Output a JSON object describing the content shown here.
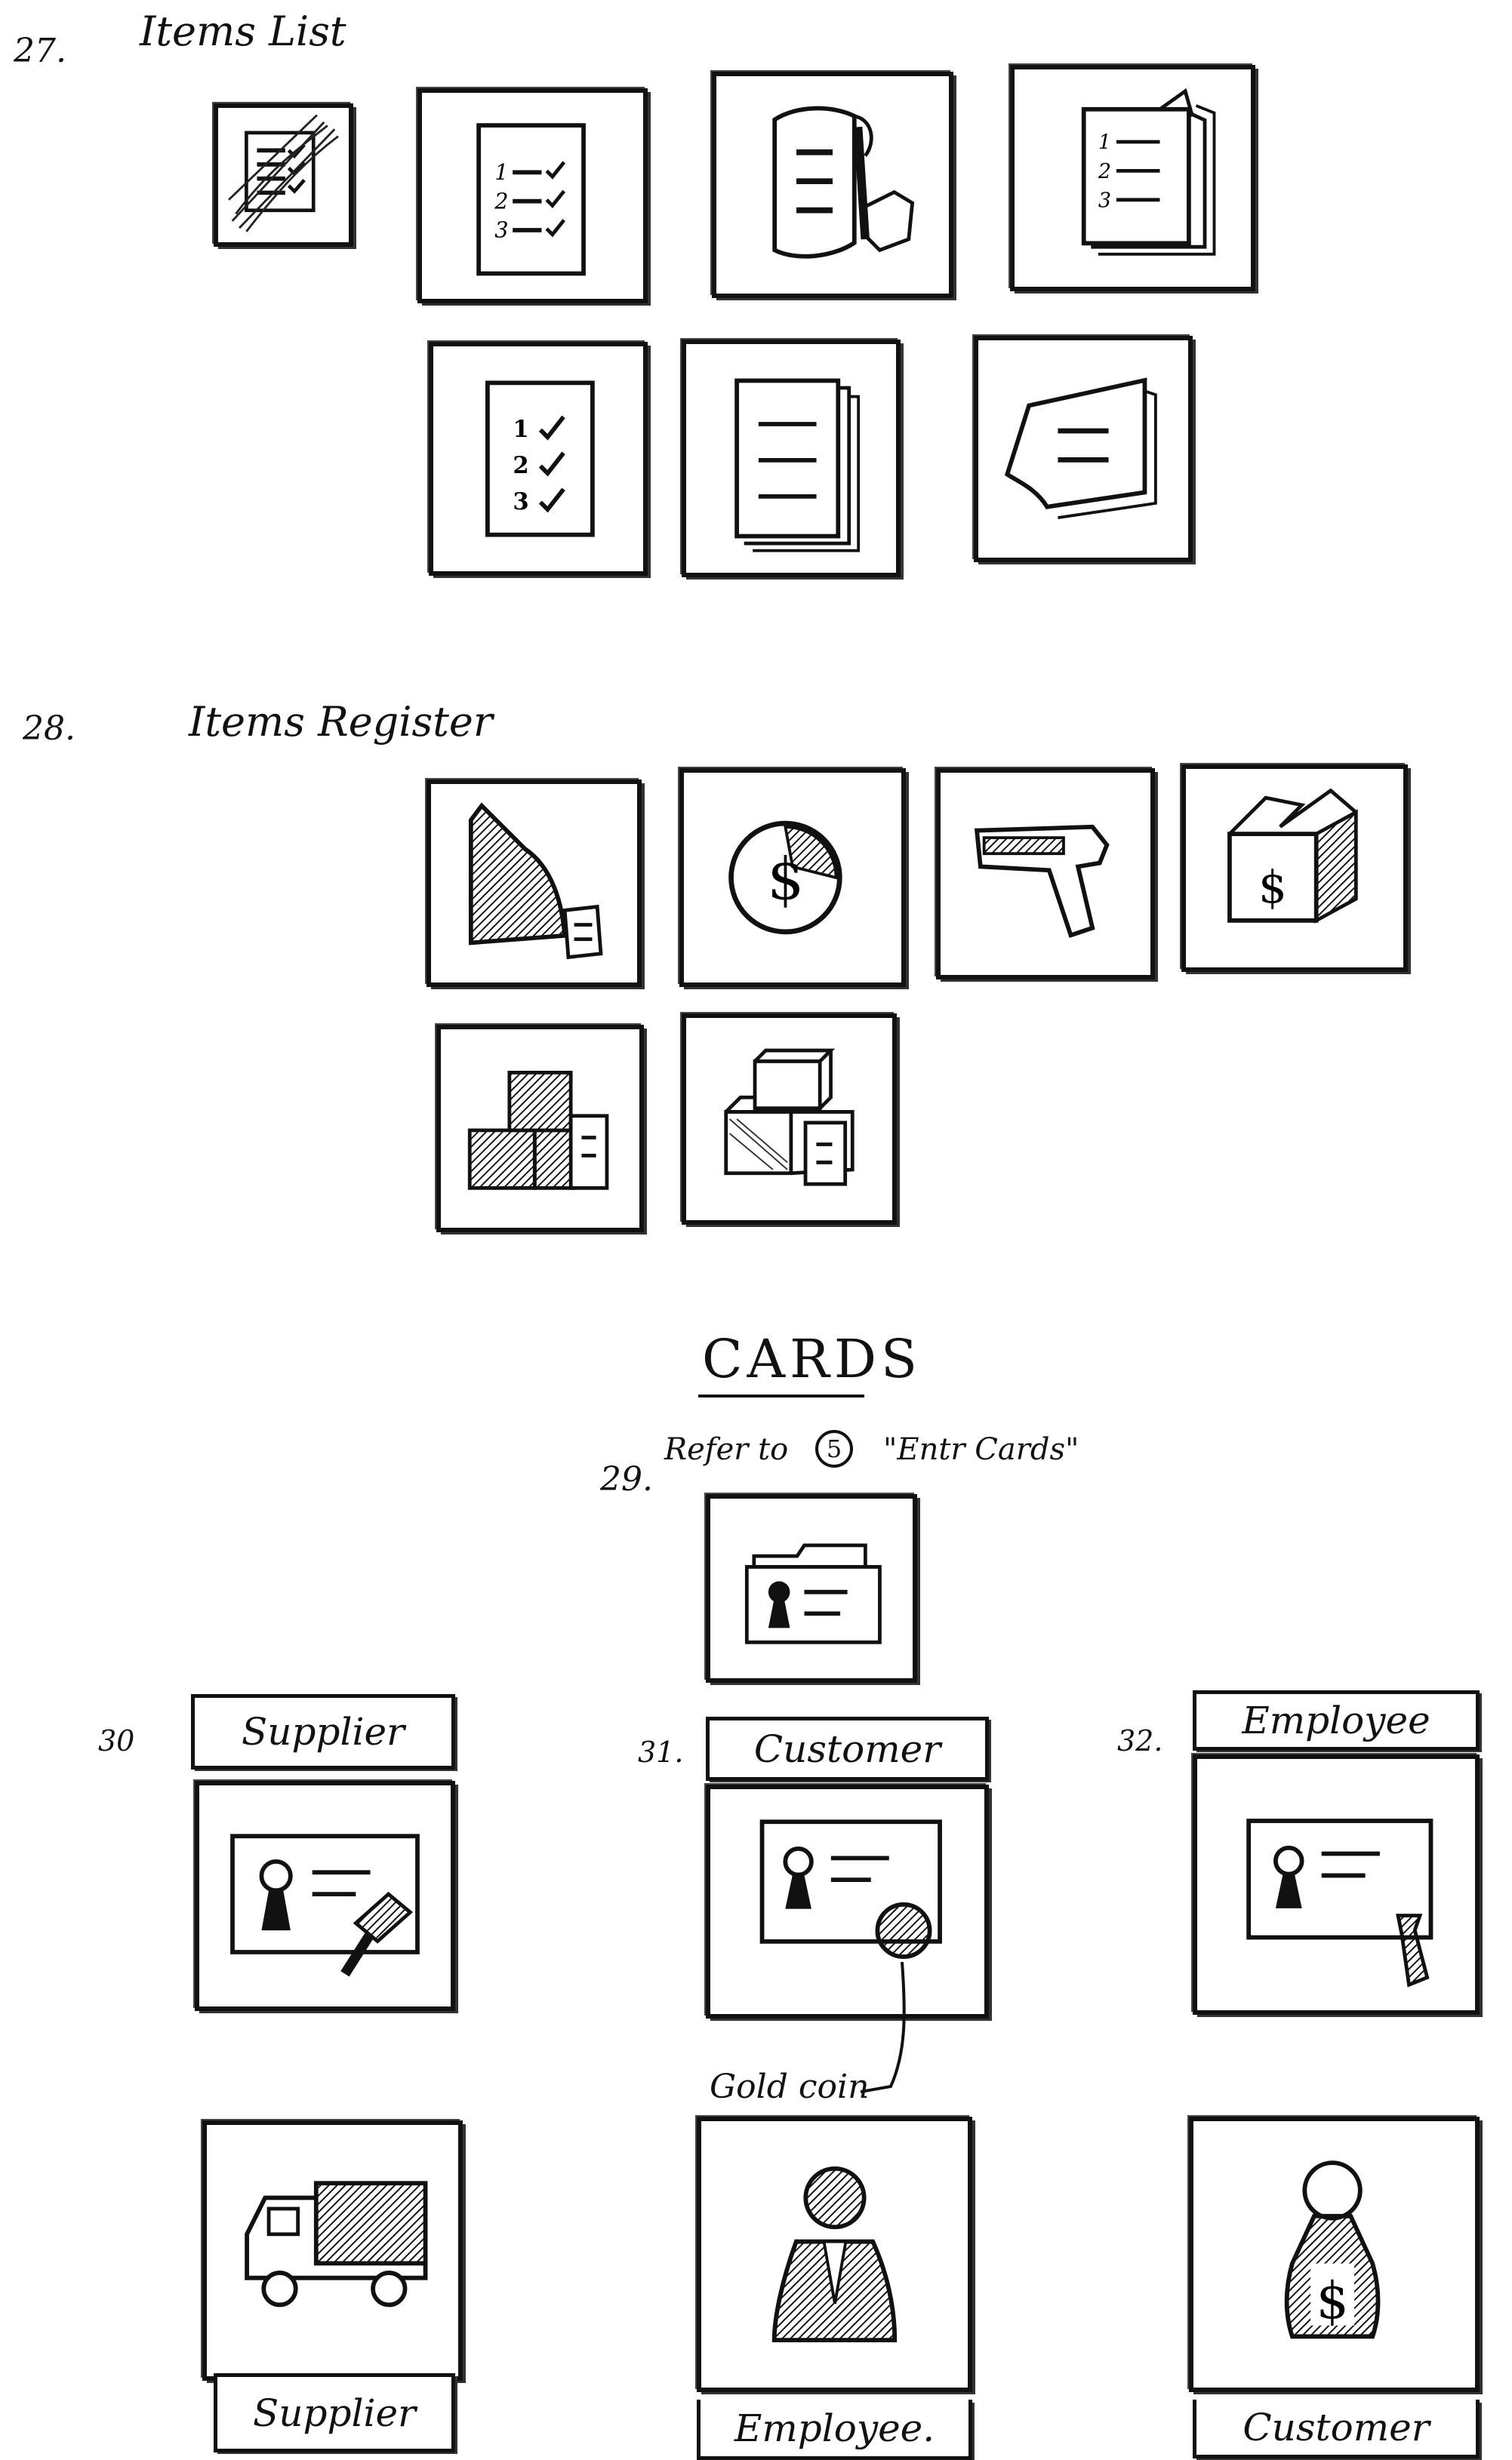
{
  "sections": {
    "items_list": {
      "number": "27.",
      "title": "Items List"
    },
    "items_register": {
      "number": "28.",
      "title": "Items Register"
    },
    "cards": {
      "heading": "CARDS",
      "refer_number": "29.",
      "refer_text_before": "Refer to",
      "refer_circle": "5",
      "refer_text_after": "\"Entr Cards\""
    },
    "supplier": {
      "number": "30",
      "top_label": "Supplier",
      "bottom_label": "Supplier"
    },
    "customer": {
      "number": "31.",
      "top_label": "Customer",
      "bottom_label": "Employee."
    },
    "employee": {
      "number": "32.",
      "top_label": "Employee",
      "bottom_label": "Customer"
    },
    "annotation": {
      "gold_coin": "Gold coin"
    }
  },
  "icons": {
    "items_list": [
      "checklist-scribbled-icon",
      "numbered-checklist-icon",
      "scroll-list-icon",
      "numbered-list-stack-icon",
      "numbered-checklist-large-icon",
      "document-stack-icon",
      "sticky-note-icon"
    ],
    "items_register": [
      "folder-ledger-icon",
      "dollar-coin-icon",
      "barcode-scanner-icon",
      "dollar-box-icon",
      "box-stack-icon",
      "box-pile-icon"
    ],
    "cards": [
      "card-folder-icon",
      "supplier-card-hammer-icon",
      "customer-card-coin-icon",
      "employee-card-tie-icon",
      "delivery-truck-icon",
      "employee-figure-icon",
      "customer-money-bag-icon"
    ]
  },
  "colors": {
    "ink": "#111111",
    "paper": "#ffffff"
  }
}
